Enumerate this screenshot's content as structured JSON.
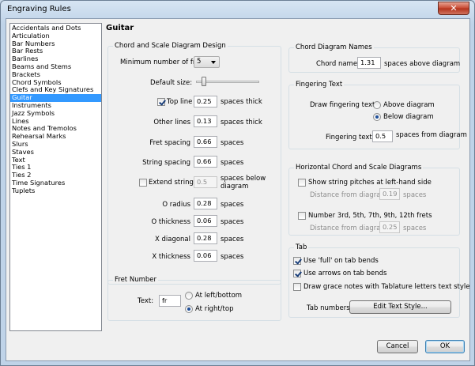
{
  "window": {
    "title": "Engraving Rules",
    "close_glyph": "✕"
  },
  "sidebar": {
    "items": [
      {
        "label": "Accidentals and Dots"
      },
      {
        "label": "Articulation"
      },
      {
        "label": "Bar Numbers"
      },
      {
        "label": "Bar Rests"
      },
      {
        "label": "Barlines"
      },
      {
        "label": "Beams and Stems"
      },
      {
        "label": "Brackets"
      },
      {
        "label": "Chord Symbols"
      },
      {
        "label": "Clefs and Key Signatures"
      },
      {
        "label": "Guitar"
      },
      {
        "label": "Instruments"
      },
      {
        "label": "Jazz Symbols"
      },
      {
        "label": "Lines"
      },
      {
        "label": "Notes and Tremolos"
      },
      {
        "label": "Rehearsal Marks"
      },
      {
        "label": "Slurs"
      },
      {
        "label": "Staves"
      },
      {
        "label": "Text"
      },
      {
        "label": "Ties 1"
      },
      {
        "label": "Ties 2"
      },
      {
        "label": "Time Signatures"
      },
      {
        "label": "Tuplets"
      }
    ],
    "selected": "Guitar"
  },
  "page": {
    "title": "Guitar"
  },
  "chord_scale": {
    "group_title": "Chord and Scale Diagram Design",
    "min_frets_label": "Minimum number of frets:",
    "min_frets_value": "5",
    "default_size_label": "Default size:",
    "default_size_level": 0.1,
    "top_line_label": "Top line",
    "top_line_value": "0.25",
    "other_lines_label": "Other lines",
    "other_lines_value": "0.13",
    "fret_spacing_label": "Fret spacing",
    "fret_spacing_value": "0.66",
    "string_spacing_label": "String spacing",
    "string_spacing_value": "0.66",
    "extend_strings_label": "Extend strings",
    "extend_strings_value": "0.5",
    "o_radius_label": "O radius",
    "o_radius_value": "0.28",
    "o_thickness_label": "O thickness",
    "o_thickness_value": "0.06",
    "x_diagonal_label": "X diagonal",
    "x_diagonal_value": "0.28",
    "x_thickness_label": "X thickness",
    "x_thickness_value": "0.06",
    "unit_spaces_thick": "spaces thick",
    "unit_spaces": "spaces",
    "unit_spaces_below": "spaces below",
    "unit_diagram": "diagram"
  },
  "fret_number": {
    "group_title": "Fret Number",
    "text_label": "Text:",
    "text_value": "fr",
    "option_left_bottom": "At left/bottom",
    "option_right_top": "At right/top"
  },
  "chord_names": {
    "group_title": "Chord Diagram Names",
    "name_label": "Chord name:",
    "name_value": "1.31",
    "unit": "spaces above diagram"
  },
  "fingering": {
    "group_title": "Fingering Text",
    "draw_label": "Draw fingering text:",
    "option_above": "Above diagram",
    "option_below": "Below diagram",
    "text_label": "Fingering text:",
    "text_value": "0.5",
    "unit": "spaces from diagram"
  },
  "horizontal": {
    "group_title": "Horizontal Chord and Scale Diagrams",
    "show_strings_label": "Show string pitches at left-hand side",
    "distance_label": "Distance from diagram:",
    "distance1_value": "0.19",
    "number_frets_label": "Number 3rd, 5th, 7th, 9th, 12th frets",
    "distance2_value": "0.25",
    "unit": "spaces"
  },
  "tab": {
    "group_title": "Tab",
    "use_full_label": "Use 'full' on tab bends",
    "use_arrows_label": "Use arrows on tab bends",
    "grace_notes_label": "Draw grace notes with Tablature letters text style",
    "tab_numbers_label": "Tab numbers:",
    "edit_text_style_label": "Edit Text Style..."
  },
  "footer": {
    "cancel_label": "Cancel",
    "ok_label": "OK"
  }
}
